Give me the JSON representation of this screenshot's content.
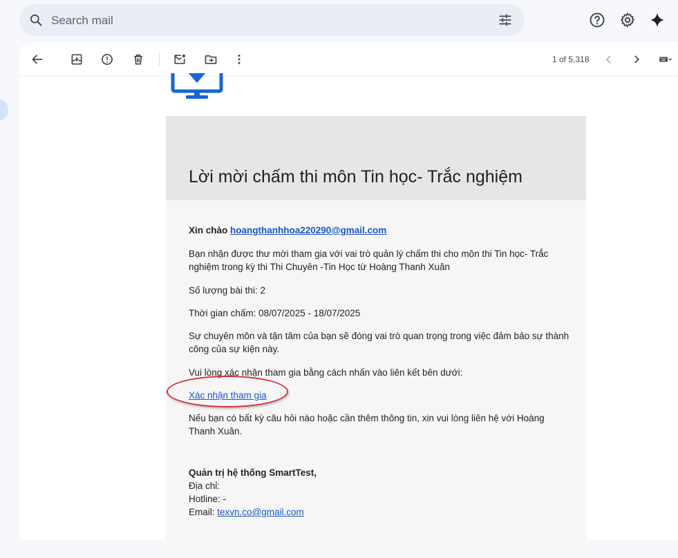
{
  "search": {
    "placeholder": "Search mail"
  },
  "toolbar": {
    "page_count": "1 of 5,318"
  },
  "email": {
    "title": "Lời mời chấm thi môn Tin học- Trắc nghiệm",
    "greeting": "Xin chào",
    "greeting_email": "hoangthanhhoa220290@gmail.com",
    "intro_line1": "Bạn nhận được thư mời tham gia với vai trò quản lý chấm thi cho môn thi Tin học- Trắc",
    "intro_line2": "nghiệm trong kỳ thi Thi Chuyên -Tin Học từ Hoàng Thanh Xuân",
    "count_line": "Số lượng bài thi: 2",
    "time_line": "Thời gian chấm: 08/07/2025 - 18/07/2025",
    "expertise_line1": "Sự chuyên môn và tận tâm của bạn sẽ đóng vai trò quan trọng trong việc đảm bảo sự thành",
    "expertise_line2": "công của sự kiện này.",
    "confirm_prompt": "Vui lòng xác nhận tham gia bằng cách nhấn vào liên kết bên dưới:",
    "confirm_link": "Xác nhận tham gia",
    "contact_line1": "Nếu bạn có bất kỳ câu hỏi nào hoặc cần thêm thông tin, xin vui lòng liên hệ với Hoàng",
    "contact_line2": "Thanh Xuân.",
    "signature_name": "Quản trị hệ thống SmartTest,",
    "address_label": "Địa chỉ:",
    "hotline_label": "Hotline: -",
    "email_label": "Email: ",
    "email_value": "texvn.co@gmail.com"
  },
  "colors": {
    "accent": "#1a55c5",
    "circle": "#d3303a",
    "logo": "#1565d8"
  }
}
